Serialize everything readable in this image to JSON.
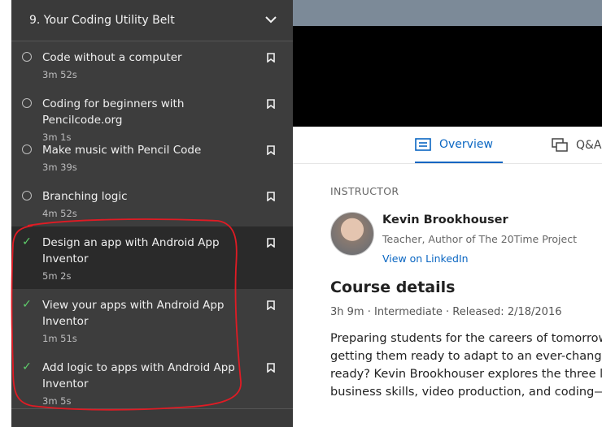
{
  "sidebar": {
    "chapter_title": "9. Your Coding Utility Belt",
    "items": [
      {
        "title": "Code without a computer",
        "duration": "3m 52s",
        "done": false
      },
      {
        "title": "Coding for beginners with Pencilcode.org",
        "duration": "3m 1s",
        "done": false
      },
      {
        "title": "Make music with Pencil Code",
        "duration": "3m 39s",
        "done": false
      },
      {
        "title": "Branching logic",
        "duration": "4m 52s",
        "done": false
      },
      {
        "title": "Design an app with Android App Inventor",
        "duration": "5m 2s",
        "done": true,
        "active": true
      },
      {
        "title": "View your apps with Android App Inventor",
        "duration": "1m 51s",
        "done": true
      },
      {
        "title": "Add logic to apps with Android App Inventor",
        "duration": "3m 5s",
        "done": true
      }
    ]
  },
  "tabs": {
    "overview": "Overview",
    "qa": "Q&A"
  },
  "instructor": {
    "section_label": "INSTRUCTOR",
    "name": "Kevin Brookhouser",
    "role": "Teacher, Author of The 20Time Project",
    "link": "View on LinkedIn"
  },
  "course": {
    "title": "Course details",
    "duration": "3h 9m",
    "level": "Intermediate",
    "released": "Released: 2/18/2016",
    "description_lines": [
      "Preparing students for the careers of tomorrow",
      "getting them ready to adapt to an ever-changin",
      "ready? Kevin Brookhouser explores the three lite",
      "business skills, video production, and coding—a"
    ]
  },
  "colors": {
    "accent": "#0a66c2",
    "check": "#5fcf6b",
    "sidebar_bg": "#3d3d3d",
    "annotation": "#e01b24"
  }
}
